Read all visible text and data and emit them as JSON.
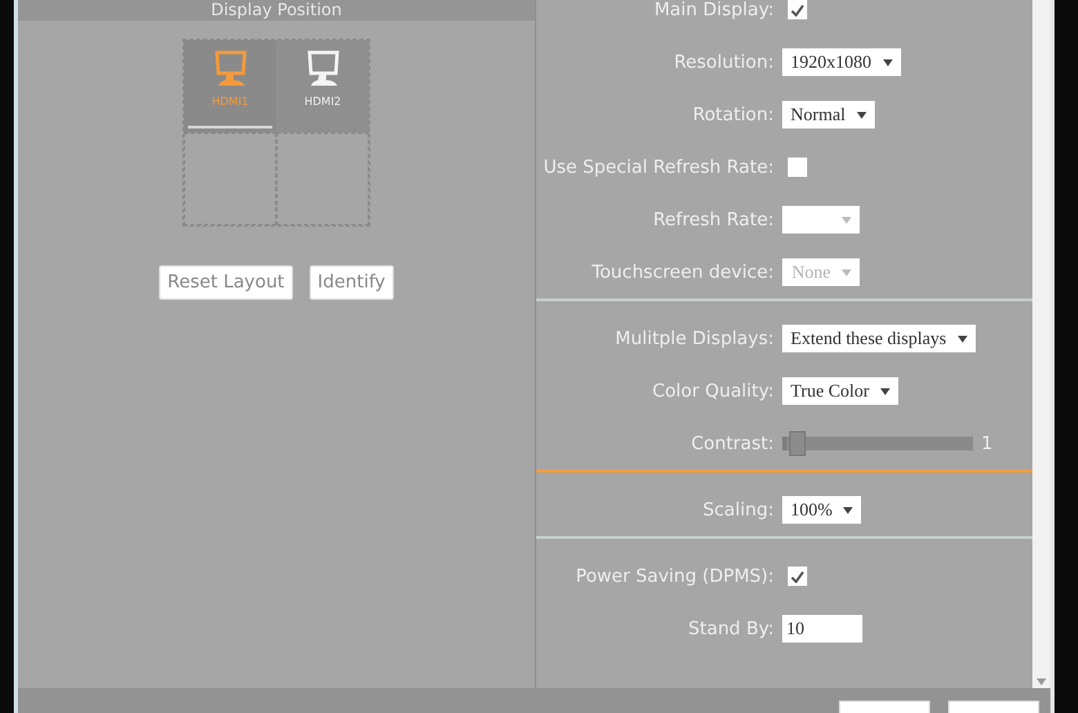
{
  "left_panel": {
    "title": "Display Position",
    "displays": [
      {
        "label": "HDMI1",
        "selected": true
      },
      {
        "label": "HDMI2",
        "selected": false
      }
    ],
    "buttons": [
      "Reset Layout",
      "Identify"
    ]
  },
  "settings": [
    {
      "accent": false,
      "rows": [
        {
          "kind": "checkbox",
          "label": "Main Display:",
          "checked": true
        },
        {
          "kind": "select",
          "label": "Resolution:",
          "value": "1920x1080",
          "disabled": false
        },
        {
          "kind": "select",
          "label": "Rotation:",
          "value": "Normal",
          "disabled": false
        },
        {
          "kind": "checkbox",
          "label": "Use Special Refresh Rate:",
          "checked": false
        },
        {
          "kind": "select",
          "label": "Refresh Rate:",
          "disabled": true
        },
        {
          "kind": "select",
          "label": "Touchscreen device:",
          "value": "None",
          "disabled": true
        }
      ]
    },
    {
      "accent": true,
      "rows": [
        {
          "kind": "select",
          "label": "Mulitple Displays:",
          "value": "Extend these displays",
          "disabled": false
        },
        {
          "kind": "select",
          "label": "Color Quality:",
          "value": "True Color",
          "disabled": false
        },
        {
          "kind": "slider",
          "label": "Contrast:",
          "level": 0.03,
          "reading": "1"
        }
      ]
    },
    {
      "accent": false,
      "rows": [
        {
          "kind": "select",
          "label": "Scaling:",
          "value": "100%",
          "disabled": false
        }
      ]
    },
    {
      "accent": false,
      "rows": [
        {
          "kind": "checkbox",
          "label": "Power Saving (DPMS):",
          "checked": true
        },
        {
          "kind": "text",
          "label": "Stand By:",
          "value": "10"
        }
      ]
    }
  ]
}
